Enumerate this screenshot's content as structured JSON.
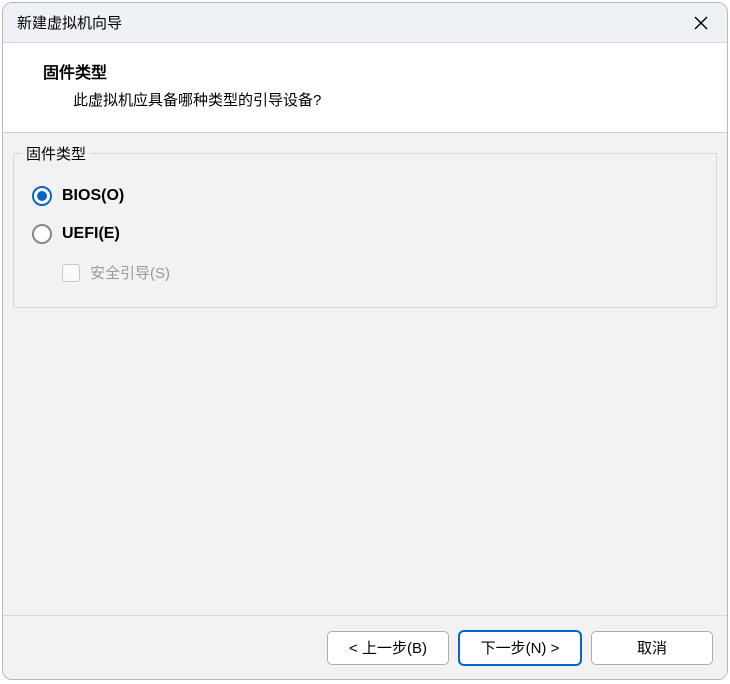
{
  "window": {
    "title": "新建虚拟机向导"
  },
  "header": {
    "title": "固件类型",
    "subtitle": "此虚拟机应具备哪种类型的引导设备?"
  },
  "group": {
    "legend": "固件类型",
    "options": {
      "bios": {
        "label": "BIOS(O)",
        "selected": true
      },
      "uefi": {
        "label": "UEFI(E)",
        "selected": false
      },
      "secure_boot": {
        "label": "安全引导(S)",
        "enabled": false,
        "checked": false
      }
    }
  },
  "footer": {
    "back": "< 上一步(B)",
    "next": "下一步(N) >",
    "cancel": "取消"
  }
}
